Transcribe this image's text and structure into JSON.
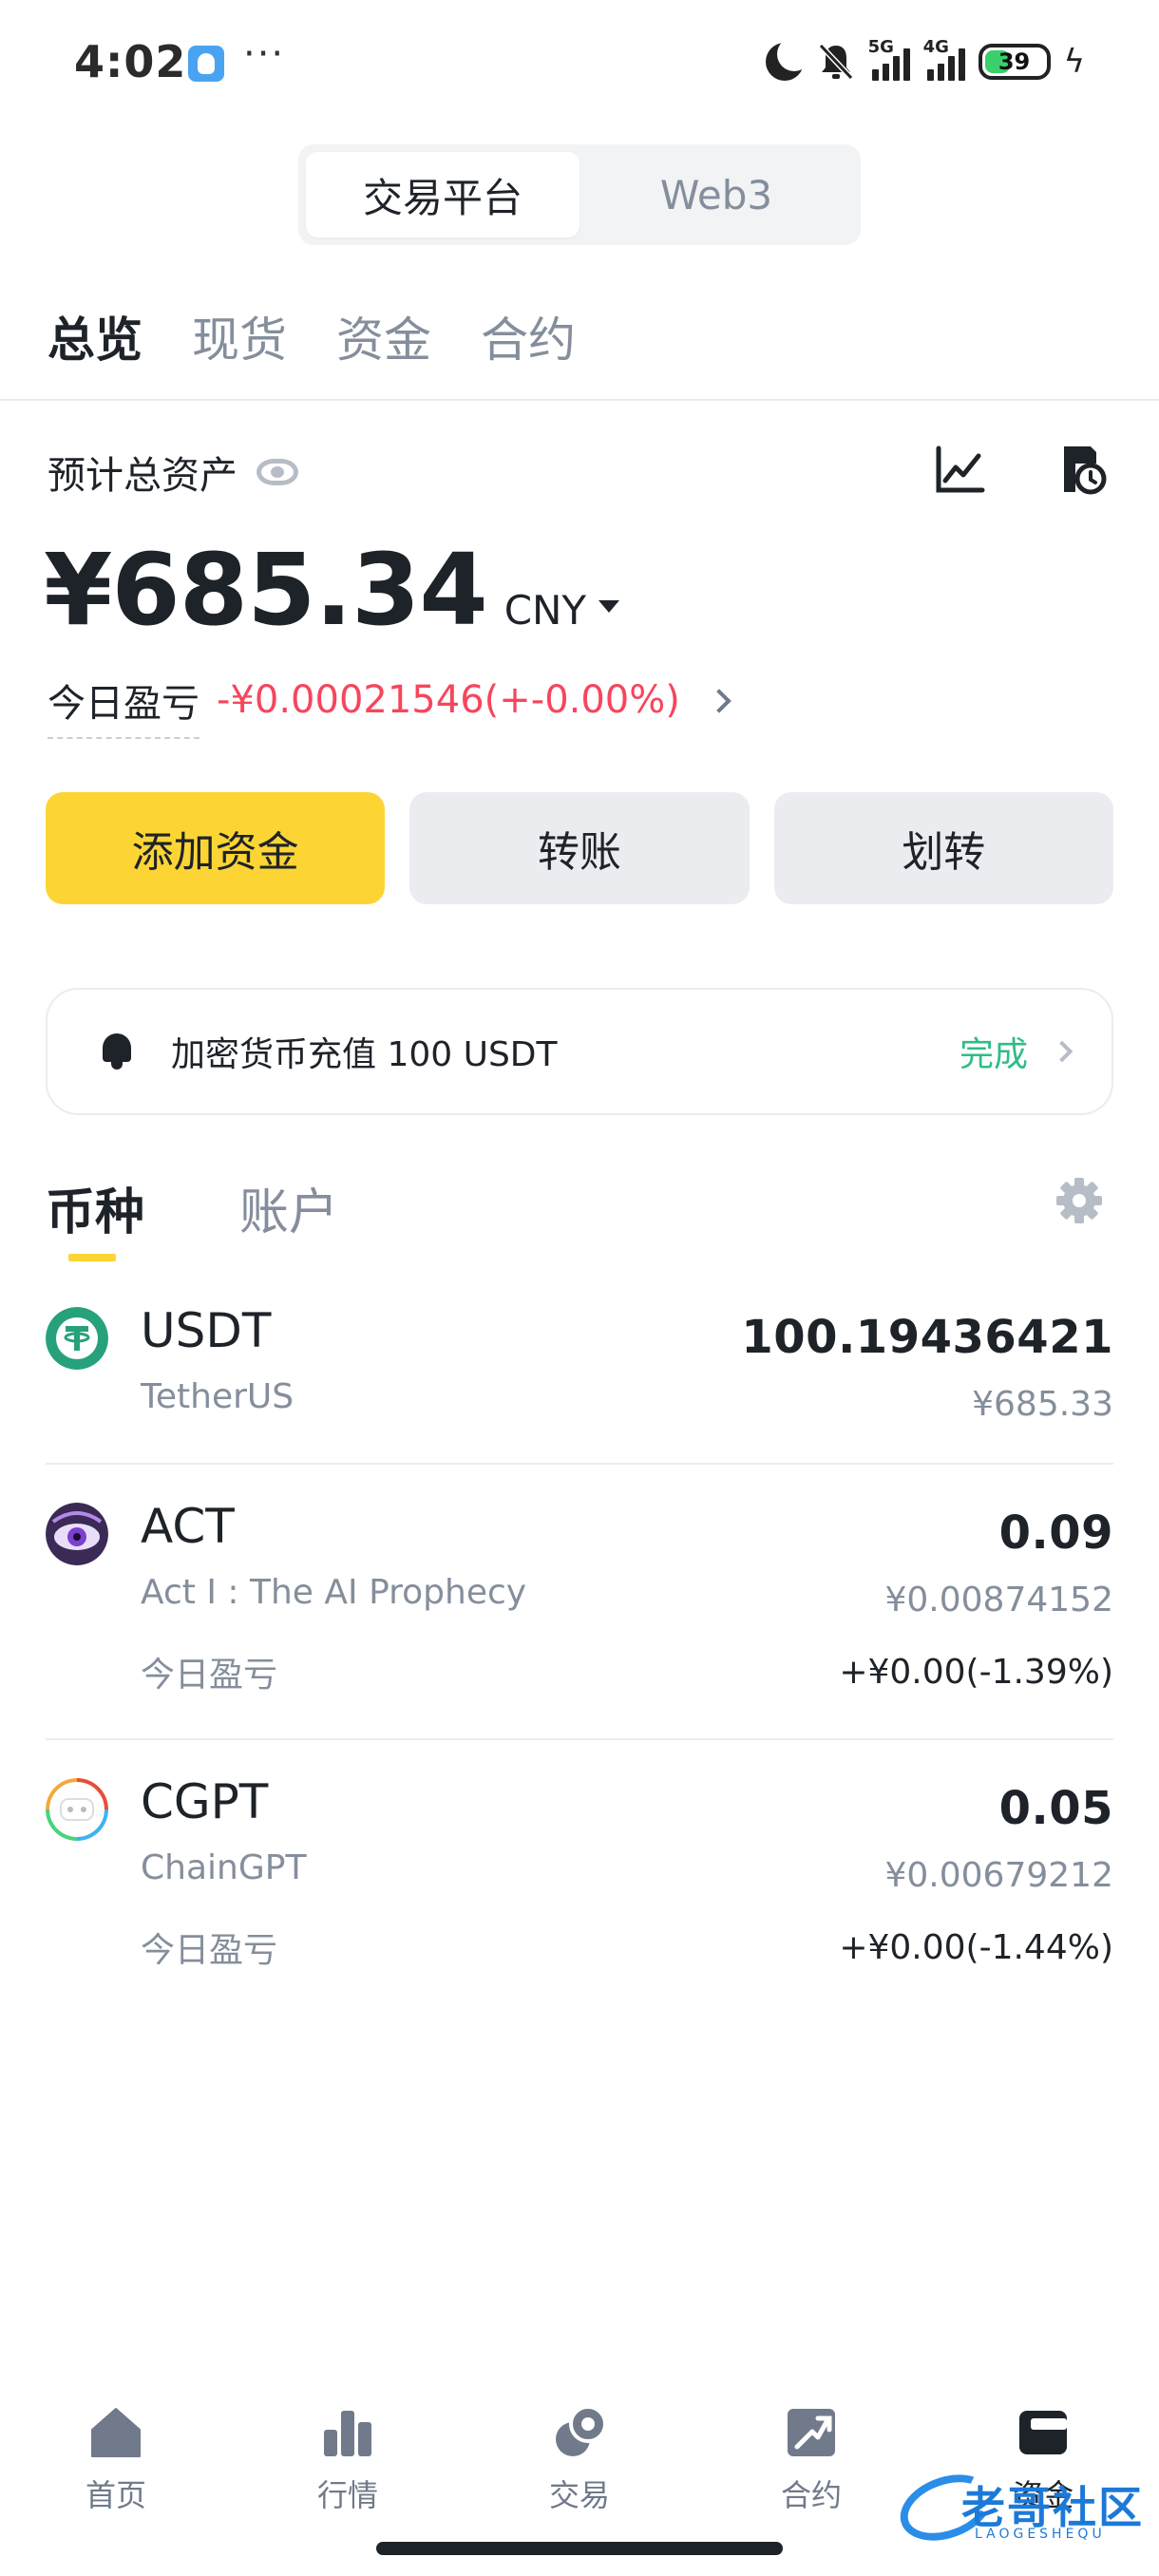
{
  "status_bar": {
    "time": "4:02",
    "dots": "···",
    "battery": "39",
    "network_1": "5G",
    "network_2": "4G"
  },
  "segment": {
    "items": [
      {
        "label": "交易平台",
        "active": true
      },
      {
        "label": "Web3",
        "active": false
      }
    ]
  },
  "main_tabs": [
    {
      "label": "总览",
      "active": true
    },
    {
      "label": "现货",
      "active": false
    },
    {
      "label": "资金",
      "active": false
    },
    {
      "label": "合约",
      "active": false
    }
  ],
  "overview": {
    "asset_label": "预计总资产",
    "total_value": "¥685.34",
    "currency": "CNY",
    "today_pnl_label": "今日盈亏",
    "today_pnl_value": "-¥0.00021546(+-0.00%)"
  },
  "actions": {
    "add_funds": "添加资金",
    "send": "转账",
    "transfer": "划转"
  },
  "notice": {
    "text": "加密货币充值 100 USDT",
    "status": "完成"
  },
  "sub_tabs": [
    {
      "label": "币种",
      "active": true
    },
    {
      "label": "账户",
      "active": false
    }
  ],
  "assets": [
    {
      "symbol": "USDT",
      "name": "TetherUS",
      "amount": "100.19436421",
      "value": "¥685.33",
      "pnl_label": "",
      "pnl": ""
    },
    {
      "symbol": "ACT",
      "name": "Act I : The AI Prophecy",
      "amount": "0.09",
      "value": "¥0.00874152",
      "pnl_label": "今日盈亏",
      "pnl": "+¥0.00(-1.39%)"
    },
    {
      "symbol": "CGPT",
      "name": "ChainGPT",
      "amount": "0.05",
      "value": "¥0.00679212",
      "pnl_label": "今日盈亏",
      "pnl": "+¥0.00(-1.44%)"
    }
  ],
  "bottom_nav": [
    {
      "label": "首页",
      "icon": "home-icon",
      "active": false
    },
    {
      "label": "行情",
      "icon": "markets-icon",
      "active": false
    },
    {
      "label": "交易",
      "icon": "trade-icon",
      "active": false
    },
    {
      "label": "合约",
      "icon": "futures-icon",
      "active": false
    },
    {
      "label": "资金",
      "icon": "wallet-icon",
      "active": true
    }
  ],
  "watermark": {
    "text": "老哥社区",
    "sub": "LAOGESHEQU"
  },
  "colors": {
    "accent": "#fcd535",
    "negative": "#f6465d",
    "positive": "#2ebd85",
    "text_primary": "#1e2329",
    "text_secondary": "#848e9c"
  }
}
